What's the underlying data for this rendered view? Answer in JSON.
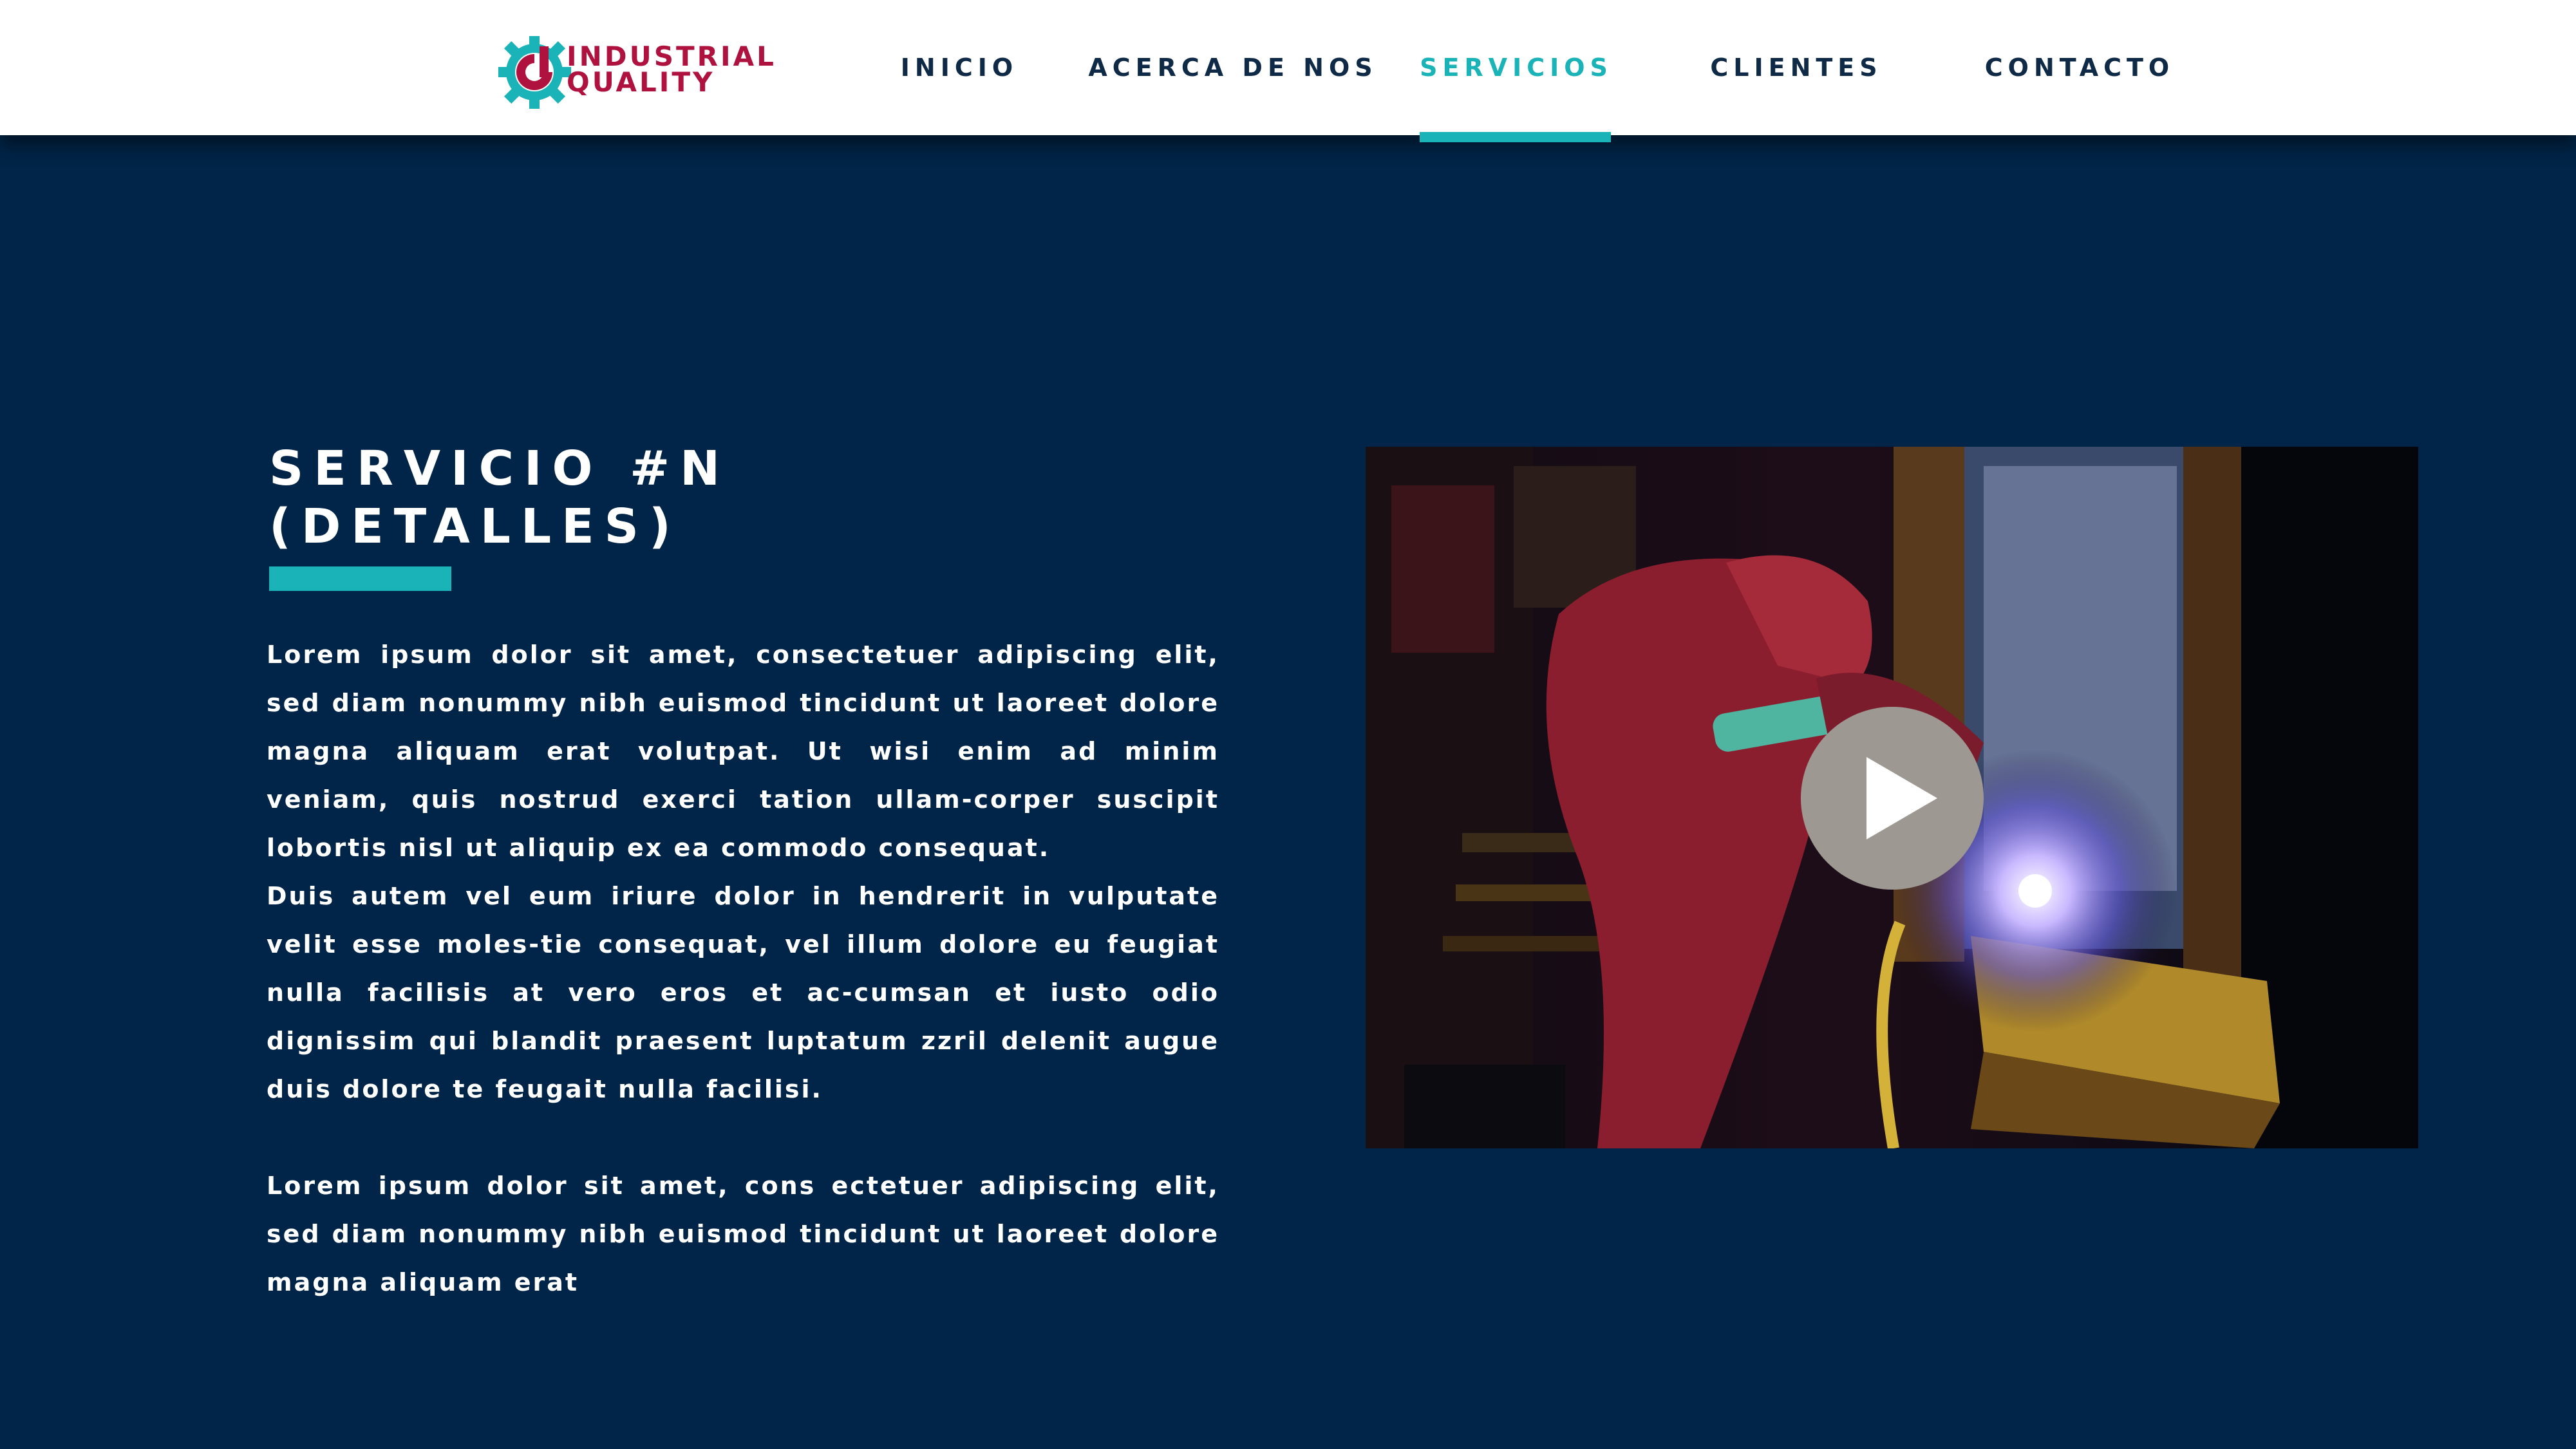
{
  "brand": {
    "line1": "INDUSTRIAL",
    "line2": "QUALITY",
    "color": "#b0123f",
    "mark_color": "#1ab3b7"
  },
  "nav": {
    "items": [
      {
        "label": "INICIO"
      },
      {
        "label": "ACERCA DE NOS"
      },
      {
        "label": "SERVICIOS"
      },
      {
        "label": "CLIENTES"
      },
      {
        "label": "CONTACTO"
      }
    ],
    "active": "SERVICIOS",
    "active_color": "#1ab3b7"
  },
  "section": {
    "title_line1": "SERVICIO #N",
    "title_line2": "(DETALLES)",
    "paragraph1": "Lorem ipsum dolor sit amet, consectetuer adipiscing elit, sed diam nonummy nibh euismod tincidunt ut laoreet dolore magna aliquam erat volutpat. Ut wisi enim ad minim veniam, quis nostrud exerci tation ullam-corper suscipit lobortis nisl ut aliquip ex ea commodo consequat.",
    "paragraph2": "Duis autem vel eum iriure dolor in hendrerit in vulputate velit esse moles-tie consequat, vel illum dolore eu feugiat nulla facilisis at vero eros et ac-cumsan et iusto odio dignissim qui blandit praesent luptatum zzril delenit augue duis dolore te feugait nulla facilisi.",
    "paragraph3": "Lorem ipsum dolor sit amet, cons ectetuer adipiscing elit, sed diam nonummy nibh euismod tincidunt ut laoreet dolore magna aliquam erat"
  },
  "video": {
    "play_icon": "play-icon"
  },
  "colors": {
    "background": "#012548",
    "accent": "#1ab3b7",
    "header": "#ffffff"
  }
}
